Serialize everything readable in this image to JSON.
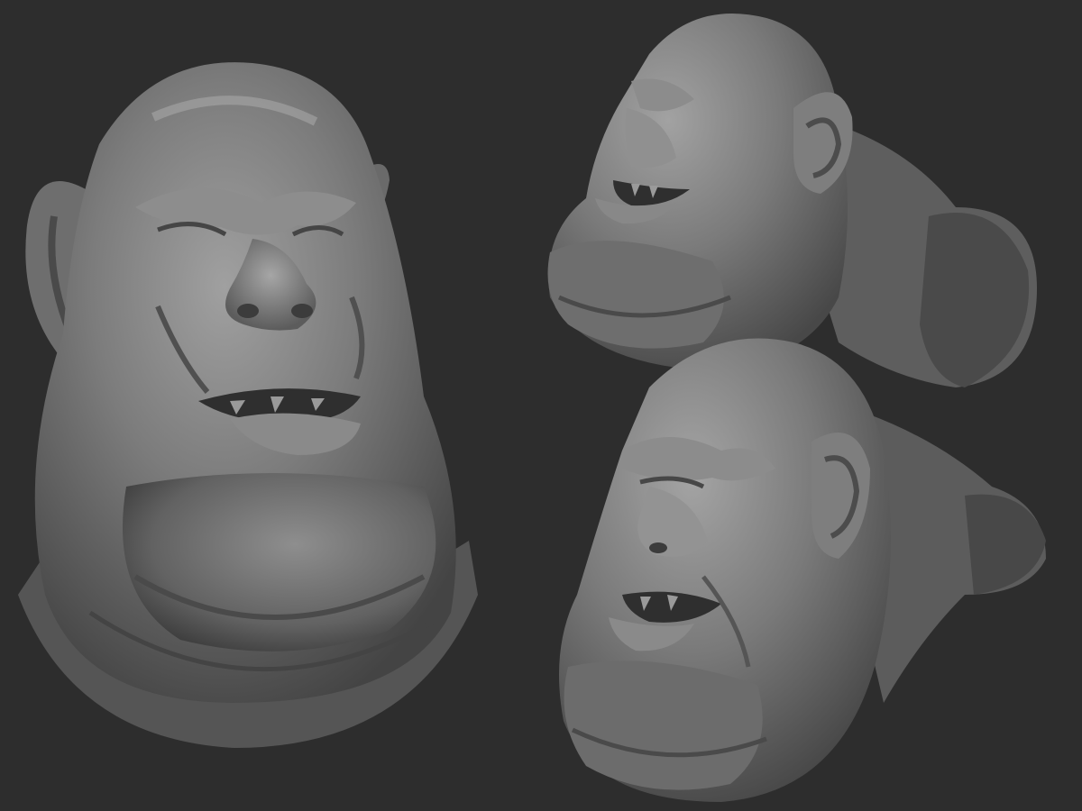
{
  "scene": {
    "background_color": "#2d2d2d",
    "material_color": "#7a7a7a",
    "shadow_color": "#3a3a3a",
    "highlight_color": "#a8a8a8"
  },
  "views": [
    {
      "view": "front",
      "subject": "ogre-head"
    },
    {
      "view": "side",
      "subject": "ogre-head"
    },
    {
      "view": "three-quarter",
      "subject": "ogre-head"
    }
  ]
}
